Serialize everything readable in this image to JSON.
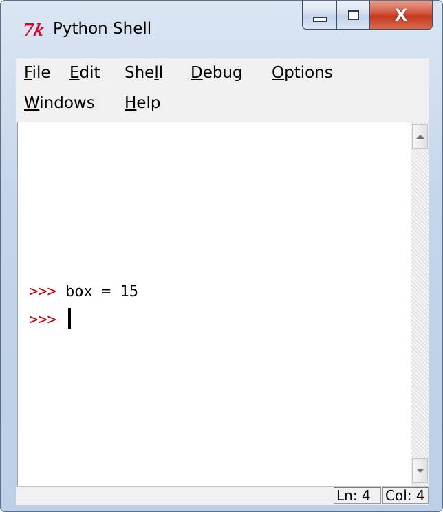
{
  "window": {
    "title": "Python Shell",
    "icon_text": "7𝑘"
  },
  "menu": [
    {
      "label_mnemonic": "F",
      "label_rest": "ile"
    },
    {
      "label_mnemonic": "E",
      "label_rest": "dit"
    },
    {
      "label_pre": "She",
      "label_mnemonic": "l",
      "label_rest": "l"
    },
    {
      "label_mnemonic": "D",
      "label_rest": "ebug"
    },
    {
      "label_mnemonic": "O",
      "label_rest": "ptions"
    },
    {
      "label_mnemonic": "W",
      "label_rest": "indows"
    },
    {
      "label_mnemonic": "H",
      "label_rest": "elp"
    }
  ],
  "shell": {
    "lines": [
      {
        "prompt": ">>>",
        "code": " box = 15"
      },
      {
        "prompt": ">>>",
        "code": " "
      }
    ]
  },
  "status": {
    "line": "Ln: 4",
    "column": "Col: 4"
  },
  "colors": {
    "prompt": "#c00000",
    "close_button": "#c13a20"
  }
}
